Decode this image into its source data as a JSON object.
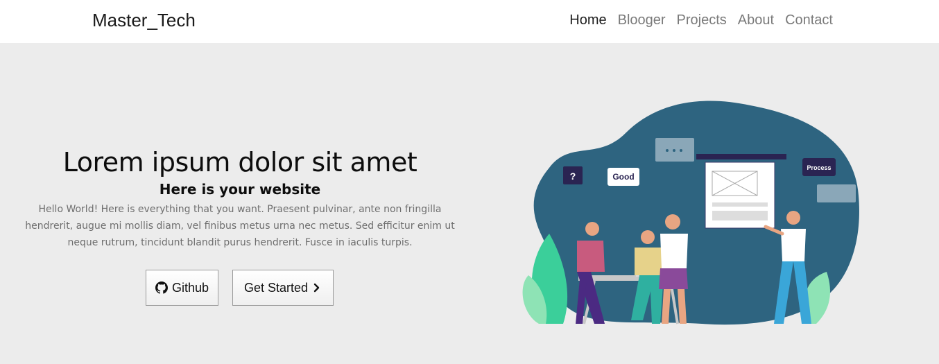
{
  "navbar": {
    "brand": "Master_Tech",
    "links": [
      {
        "label": "Home",
        "active": true
      },
      {
        "label": "Blooger",
        "active": false
      },
      {
        "label": "Projects",
        "active": false
      },
      {
        "label": "About",
        "active": false
      },
      {
        "label": "Contact",
        "active": false
      }
    ]
  },
  "hero": {
    "title": "Lorem ipsum dolor sit amet",
    "subtitle": "Here is your website",
    "body": "Hello World! Here is everything that you want. Praesent pulvinar, ante non fringilla hendrerit, augue mi mollis diam, vel finibus metus urna nec metus. Sed efficitur enim ut neque rutrum, tincidunt blandit purus hendrerit. Fusce in iaculis turpis.",
    "buttons": {
      "github_label": "Github",
      "github_icon": "github-icon",
      "start_label": "Get Started",
      "start_icon": "chevron-right-icon"
    }
  },
  "illustration": {
    "bubbles": {
      "question": "?",
      "good": "Good",
      "process": "Process"
    }
  },
  "colors": {
    "navbar_bg": "#ffffff",
    "hero_bg": "#ececec",
    "blob": "#2e6480",
    "active_link": "#1f1f1f",
    "inactive_link": "#7a7a7a"
  }
}
